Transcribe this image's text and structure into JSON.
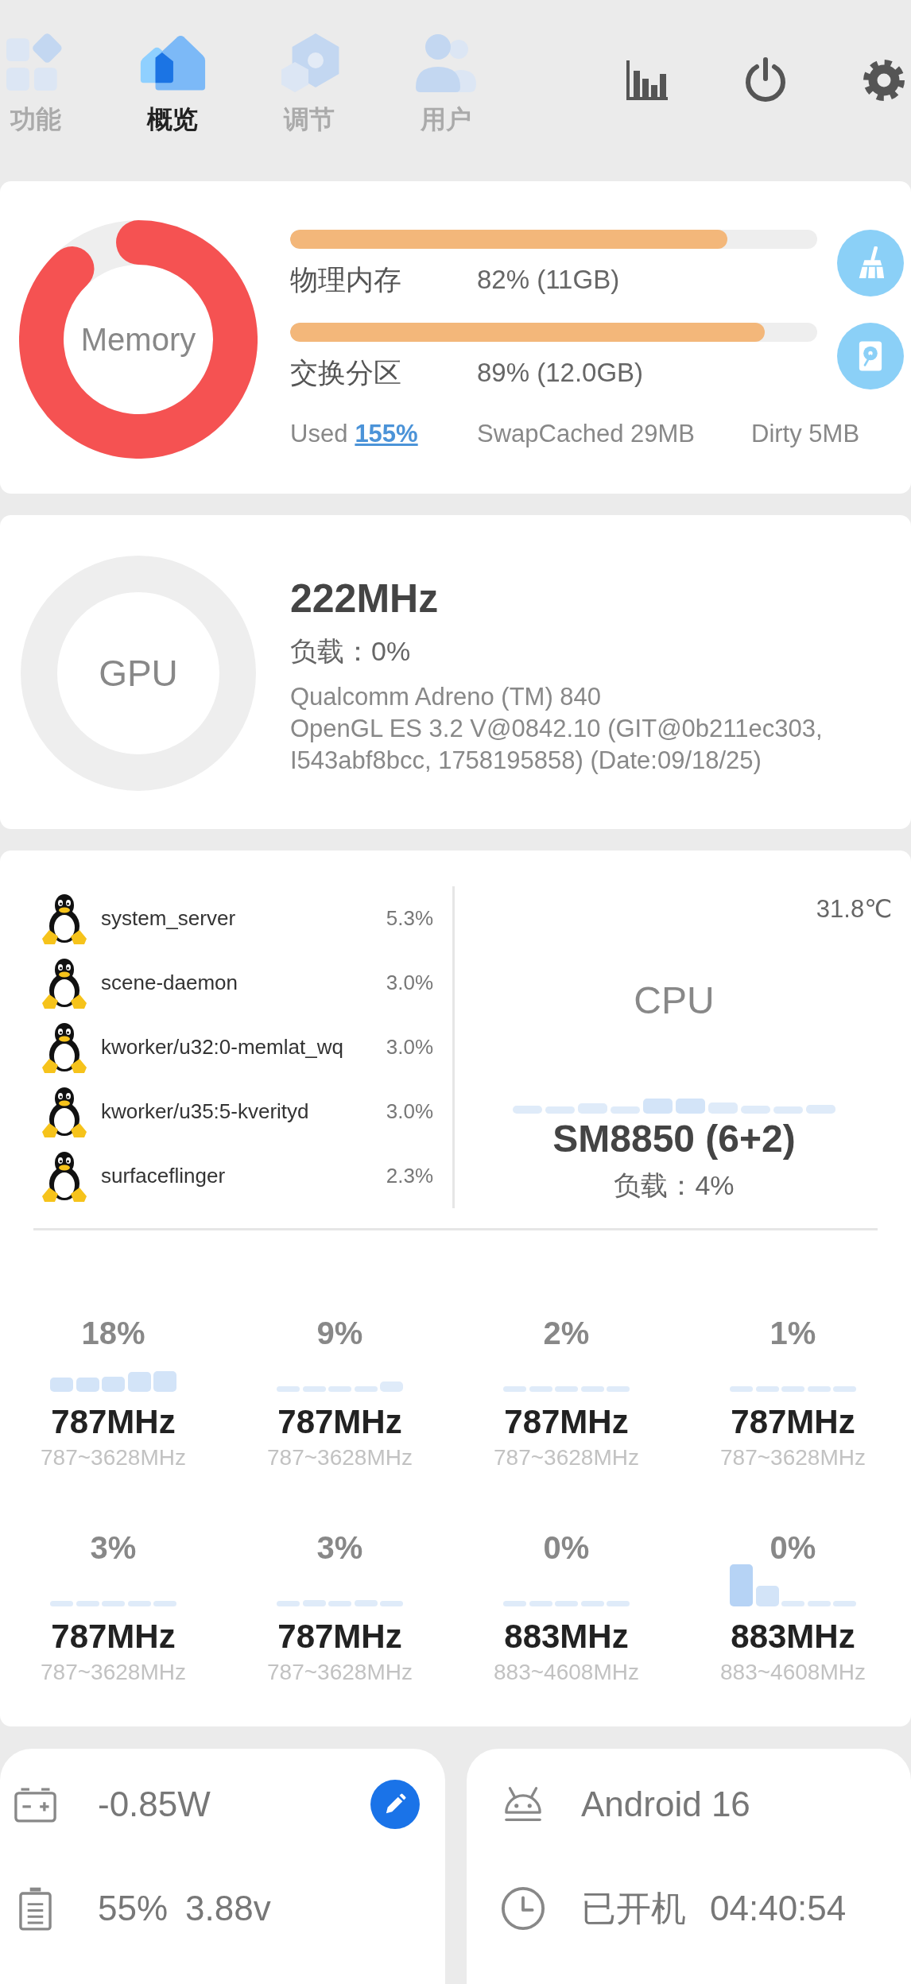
{
  "nav": {
    "tabs": [
      {
        "label": "功能",
        "selected": false
      },
      {
        "label": "概览",
        "selected": true
      },
      {
        "label": "调节",
        "selected": false
      },
      {
        "label": "用户",
        "selected": false
      }
    ]
  },
  "memory": {
    "title": "Memory",
    "meters": [
      {
        "label": "物理内存",
        "value": "82% (11GB)",
        "level": 0.83
      },
      {
        "label": "交换分区",
        "value": "89% (12.0GB)",
        "level": 0.9
      }
    ],
    "used": {
      "label": "Used",
      "value": "155%"
    },
    "swap_cached": "SwapCached 29MB",
    "dirty": "Dirty 5MB"
  },
  "gpu": {
    "title": "GPU",
    "frequency": "222MHz",
    "load": "负载：0%",
    "renderer": "Qualcomm Adreno (TM) 840",
    "version": "OpenGL ES 3.2 V@0842.10 (GIT@0b211ec303, I543abf8bcc, 1758195858) (Date:09/18/25)"
  },
  "cpu": {
    "processes": [
      {
        "name": "system_server",
        "usage": "5.3%"
      },
      {
        "name": "scene-daemon",
        "usage": "3.0%"
      },
      {
        "name": "kworker/u32:0-memlat_wq",
        "usage": "3.0%"
      },
      {
        "name": "kworker/u35:5-kverityd",
        "usage": "3.0%"
      },
      {
        "name": "surfaceflinger",
        "usage": "2.3%"
      }
    ],
    "temperature": "31.8℃",
    "title": "CPU",
    "model": "SM8850 (6+2)",
    "load": "负载：4%",
    "cores": [
      {
        "usage": "18%",
        "frequency": "787MHz",
        "range": "787~3628MHz"
      },
      {
        "usage": "9%",
        "frequency": "787MHz",
        "range": "787~3628MHz"
      },
      {
        "usage": "2%",
        "frequency": "787MHz",
        "range": "787~3628MHz"
      },
      {
        "usage": "1%",
        "frequency": "787MHz",
        "range": "787~3628MHz"
      },
      {
        "usage": "3%",
        "frequency": "787MHz",
        "range": "787~3628MHz"
      },
      {
        "usage": "3%",
        "frequency": "787MHz",
        "range": "787~3628MHz"
      },
      {
        "usage": "0%",
        "frequency": "883MHz",
        "range": "883~4608MHz"
      },
      {
        "usage": "0%",
        "frequency": "883MHz",
        "range": "883~4608MHz"
      }
    ]
  },
  "power": {
    "draw": "-0.85W",
    "battery_level": "55%",
    "voltage": "3.88v"
  },
  "system": {
    "os": "Android 16",
    "uptime_label": "已开机",
    "uptime": "04:40:54"
  }
}
